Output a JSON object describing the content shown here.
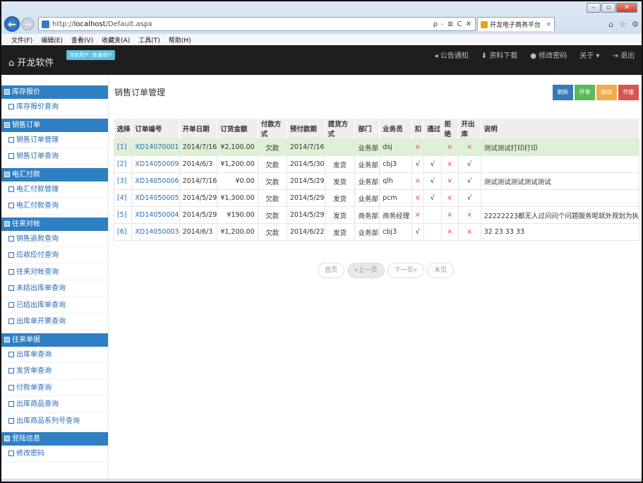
{
  "browser": {
    "address": "http://",
    "address_host": "localhost",
    "address_path": "/Default.aspx",
    "address_controls": "ρ - ≣ C ✕",
    "tab_title": "开龙电子商务平台",
    "tab_close": "×",
    "menu": [
      "文件(F)",
      "编辑(E)",
      "查看(V)",
      "收藏夹(A)",
      "工具(T)",
      "帮助(H)"
    ]
  },
  "header": {
    "brand": "开龙软件",
    "user_badge": "当前用户: 普通用户",
    "nav": [
      "公告通知",
      "资料下载",
      "修改密码",
      "关于 ▾",
      "退出"
    ]
  },
  "sidebar": {
    "groups": [
      {
        "label": "库存报价",
        "items": [
          "库存报价查询"
        ]
      },
      {
        "label": "销售订单",
        "items": [
          "销售订单管理",
          "销售订单查询"
        ]
      },
      {
        "label": "电汇付款",
        "items": [
          "电汇付款管理",
          "电汇付款查询"
        ]
      },
      {
        "label": "往来对帐",
        "items": [
          "销售返款查询",
          "应收应付查询",
          "往来对帐查询",
          "未结出库单查询",
          "已结出库单查询",
          "出库单开票查询"
        ]
      },
      {
        "label": "往来单据",
        "items": [
          "出库单查询",
          "发货单查询",
          "付款单查询",
          "出库商品查询",
          "出库商品系列号查询"
        ]
      },
      {
        "label": "登陆信息",
        "items": [
          "修改密码"
        ]
      }
    ]
  },
  "main": {
    "title": "销售订单管理",
    "buttons": {
      "refresh": "刷新",
      "add": "开单",
      "edit": "修改",
      "void": "作废"
    },
    "columns": [
      "选择",
      "订单编号",
      "开单日期",
      "订货金额",
      "付款方式",
      "预付款期",
      "提货方式",
      "部门",
      "业务员",
      "扣",
      "通过",
      "拒绝",
      "开出库",
      "说明"
    ],
    "rows": [
      {
        "sel": "[1]",
        "no": "XD14070001",
        "date": "2014/7/16",
        "amount": "¥2,100.00",
        "pay": "欠款",
        "due": "2014/7/16",
        "ship": "",
        "dept": "业务部",
        "rep": "dsj",
        "kou": "×",
        "pass": "",
        "reject": "×",
        "out": "×",
        "note": "测试测试打印打印"
      },
      {
        "sel": "[2]",
        "no": "XD14050009",
        "date": "2014/6/3",
        "amount": "¥1,200.00",
        "pay": "欠款",
        "due": "2014/5/30",
        "ship": "发货",
        "dept": "业务部",
        "rep": "cbj3",
        "kou": "√",
        "pass": "√",
        "reject": "×",
        "out": "√",
        "note": ""
      },
      {
        "sel": "[3]",
        "no": "XD14050006",
        "date": "2014/7/16",
        "amount": "¥0.00",
        "pay": "欠款",
        "due": "2014/5/29",
        "ship": "发货",
        "dept": "业务部",
        "rep": "qlh",
        "kou": "×",
        "pass": "√",
        "reject": "×",
        "out": "√",
        "note": "测试测试测试测试测试"
      },
      {
        "sel": "[4]",
        "no": "XD14050005",
        "date": "2014/5/29",
        "amount": "¥1,300.00",
        "pay": "欠款",
        "due": "2014/5/29",
        "ship": "发货",
        "dept": "业务部",
        "rep": "pcm",
        "kou": "×",
        "pass": "√",
        "reject": "×",
        "out": "√",
        "note": ""
      },
      {
        "sel": "[5]",
        "no": "XD14050004",
        "date": "2014/5/29",
        "amount": "¥190.00",
        "pay": "欠款",
        "due": "2014/5/29",
        "ship": "发货",
        "dept": "商务部",
        "rep": "商务经理",
        "kou": "×",
        "pass": "",
        "reject": "×",
        "out": "×",
        "note": "22222223都无人过问问个问题服务呢就外规划为执"
      },
      {
        "sel": "[6]",
        "no": "XD14050003",
        "date": "2014/6/3",
        "amount": "¥1,200.00",
        "pay": "欠款",
        "due": "2014/6/22",
        "ship": "发货",
        "dept": "业务部",
        "rep": "cbj3",
        "kou": "√",
        "pass": "",
        "reject": "×",
        "out": "×",
        "note": "32 23 33 33"
      }
    ],
    "pager": [
      "首页",
      "«上一页",
      "下一页»",
      "末页"
    ]
  },
  "colors": {
    "header_bg": "#1e1e1e",
    "sidebar_head": "#2f7fc3",
    "highlight_row": "#dff0d8",
    "link": "#2a6cb3"
  }
}
